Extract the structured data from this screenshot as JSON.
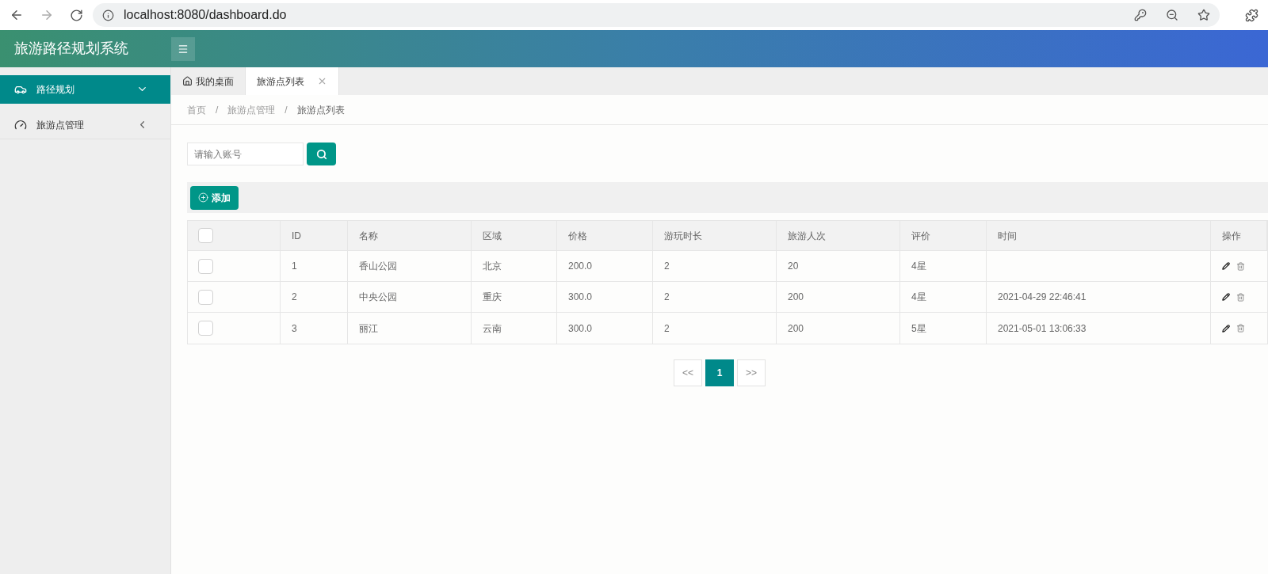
{
  "browser": {
    "url": "localhost:8080/dashboard.do"
  },
  "header": {
    "title": "旅游路径规划系统"
  },
  "sidebar": {
    "items": [
      {
        "label": "路径规划",
        "selected": true,
        "expanded": true
      },
      {
        "label": "旅游点管理",
        "selected": false,
        "expanded": false
      }
    ]
  },
  "tabs": [
    {
      "label": "我的桌面",
      "kind": "home",
      "selected": false
    },
    {
      "label": "旅游点列表",
      "kind": "closable",
      "selected": true
    }
  ],
  "breadcrumb": {
    "separator": "/",
    "items": [
      "首页",
      "旅游点管理",
      "旅游点列表"
    ]
  },
  "search": {
    "placeholder": "请输入账号"
  },
  "toolbar": {
    "add_button": "添加"
  },
  "table": {
    "header_checked": false,
    "columns": [
      "ID",
      "名称",
      "区域",
      "价格",
      "游玩时长",
      "旅游人次",
      "评价",
      "时间",
      "操作"
    ],
    "rows": [
      {
        "checked": false,
        "id": "1",
        "name": "香山公园",
        "region": "北京",
        "price": "200.0",
        "duration": "2",
        "visitors": "20",
        "rating": "4星"
      },
      {
        "checked": false,
        "id": "2",
        "name": "中央公园",
        "region": "重庆",
        "price": "300.0",
        "duration": "2",
        "visitors": "200",
        "rating": "4星",
        "time": "2021-04-29 22:46:41"
      },
      {
        "checked": false,
        "id": "3",
        "name": "丽江",
        "region": "云南",
        "price": "300.0",
        "duration": "2",
        "visitors": "200",
        "rating": "5星",
        "time": "2021-05-01 13:06:33"
      }
    ]
  },
  "pagination": {
    "prev": "<<",
    "pages": [
      {
        "label": "1",
        "selected": true
      }
    ],
    "next": ">>"
  }
}
